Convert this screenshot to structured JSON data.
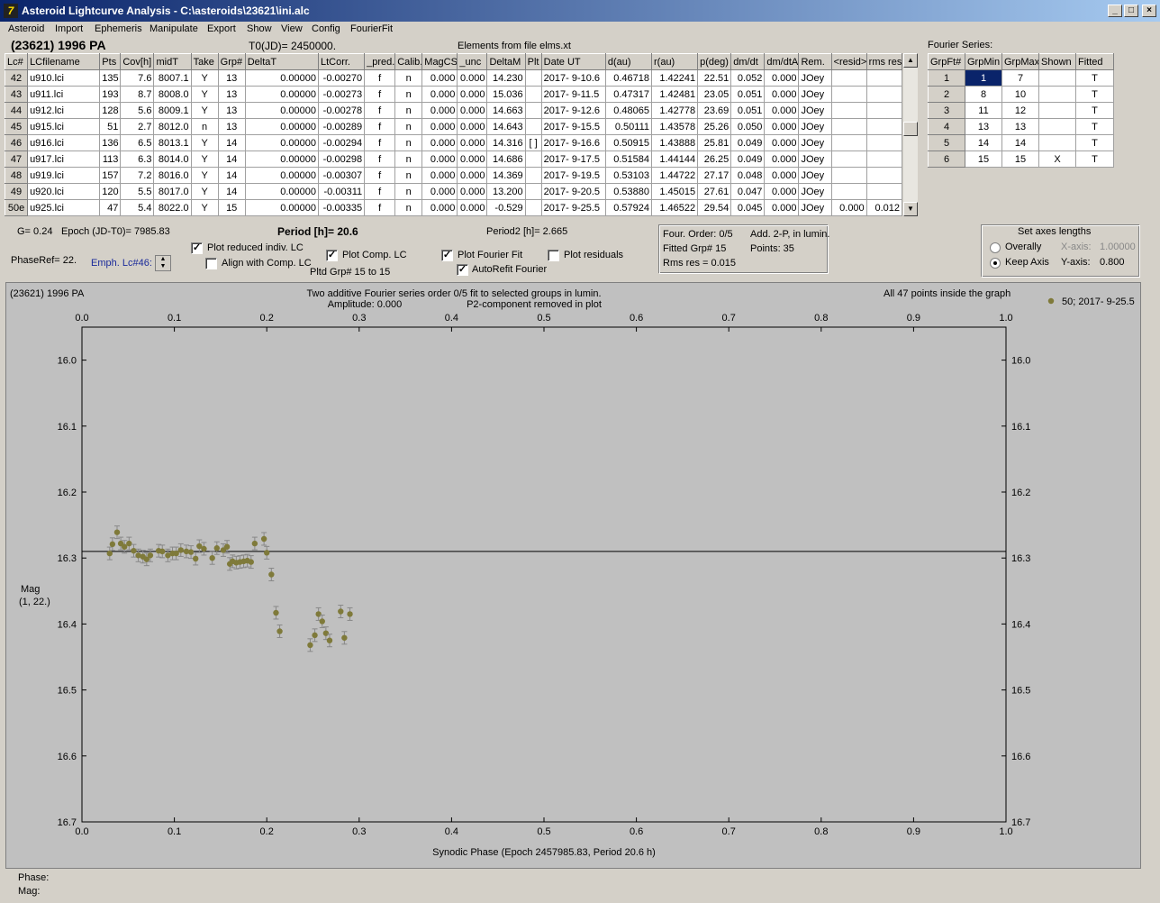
{
  "window": {
    "title": "Asteroid Lightcurve Analysis - C:\\asteroids\\23621\\ini.alc",
    "min": "_",
    "max": "□",
    "close": "×",
    "icon_letter": "7"
  },
  "menu": [
    "Asteroid",
    "Import",
    "Ephemeris",
    "Manipulate",
    "Export",
    "Show",
    "View",
    "Config",
    "FourierFit"
  ],
  "header": {
    "asteroid": "(23621) 1996 PA",
    "t0": "T0(JD)= 2450000.",
    "elements": "Elements from file elms.xt",
    "fourier_label": "Fourier Series:"
  },
  "lc_table": {
    "columns": [
      "Lc#",
      "LCfilename",
      "Pts",
      "Cov[h]",
      "midT",
      "Take",
      "Grp#",
      "DeltaT",
      "LtCorr.",
      "_pred.",
      "Calib.",
      "MagCS",
      "_unc",
      "DeltaM",
      "Plt",
      "Date UT",
      "d(au)",
      "r(au)",
      "p(deg)",
      "dm/dt",
      "dm/dtA",
      "Rem.",
      "<resid>",
      "rms res"
    ],
    "rows": [
      [
        "42",
        "u910.lci",
        "135",
        "7.6",
        "8007.1",
        "Y",
        "13",
        "0.00000",
        "-0.00270",
        "f",
        "n",
        "0.000",
        "0.000",
        "14.230",
        "",
        "2017- 9-10.6",
        "0.46718",
        "1.42241",
        "22.51",
        "0.052",
        "0.000",
        "JOey",
        "",
        ""
      ],
      [
        "43",
        "u911.lci",
        "193",
        "8.7",
        "8008.0",
        "Y",
        "13",
        "0.00000",
        "-0.00273",
        "f",
        "n",
        "0.000",
        "0.000",
        "15.036",
        "",
        "2017- 9-11.5",
        "0.47317",
        "1.42481",
        "23.05",
        "0.051",
        "0.000",
        "JOey",
        "",
        ""
      ],
      [
        "44",
        "u912.lci",
        "128",
        "5.6",
        "8009.1",
        "Y",
        "13",
        "0.00000",
        "-0.00278",
        "f",
        "n",
        "0.000",
        "0.000",
        "14.663",
        "",
        "2017- 9-12.6",
        "0.48065",
        "1.42778",
        "23.69",
        "0.051",
        "0.000",
        "JOey",
        "",
        ""
      ],
      [
        "45",
        "u915.lci",
        "51",
        "2.7",
        "8012.0",
        "n",
        "13",
        "0.00000",
        "-0.00289",
        "f",
        "n",
        "0.000",
        "0.000",
        "14.643",
        "",
        "2017- 9-15.5",
        "0.50111",
        "1.43578",
        "25.26",
        "0.050",
        "0.000",
        "JOey",
        "",
        ""
      ],
      [
        "46",
        "u916.lci",
        "136",
        "6.5",
        "8013.1",
        "Y",
        "14",
        "0.00000",
        "-0.00294",
        "f",
        "n",
        "0.000",
        "0.000",
        "14.316",
        "[ ]",
        "2017- 9-16.6",
        "0.50915",
        "1.43888",
        "25.81",
        "0.049",
        "0.000",
        "JOey",
        "",
        ""
      ],
      [
        "47",
        "u917.lci",
        "113",
        "6.3",
        "8014.0",
        "Y",
        "14",
        "0.00000",
        "-0.00298",
        "f",
        "n",
        "0.000",
        "0.000",
        "14.686",
        "",
        "2017- 9-17.5",
        "0.51584",
        "1.44144",
        "26.25",
        "0.049",
        "0.000",
        "JOey",
        "",
        ""
      ],
      [
        "48",
        "u919.lci",
        "157",
        "7.2",
        "8016.0",
        "Y",
        "14",
        "0.00000",
        "-0.00307",
        "f",
        "n",
        "0.000",
        "0.000",
        "14.369",
        "",
        "2017- 9-19.5",
        "0.53103",
        "1.44722",
        "27.17",
        "0.048",
        "0.000",
        "JOey",
        "",
        ""
      ],
      [
        "49",
        "u920.lci",
        "120",
        "5.5",
        "8017.0",
        "Y",
        "14",
        "0.00000",
        "-0.00311",
        "f",
        "n",
        "0.000",
        "0.000",
        "13.200",
        "",
        "2017- 9-20.5",
        "0.53880",
        "1.45015",
        "27.61",
        "0.047",
        "0.000",
        "JOey",
        "",
        ""
      ],
      [
        "50e",
        "u925.lci",
        "47",
        "5.4",
        "8022.0",
        "Y",
        "15",
        "0.00000",
        "-0.00335",
        "f",
        "n",
        "0.000",
        "0.000",
        "-0.529",
        "",
        "2017- 9-25.5",
        "0.57924",
        "1.46522",
        "29.54",
        "0.045",
        "0.000",
        "JOey",
        "0.000",
        "0.012"
      ]
    ]
  },
  "fourier_table": {
    "columns": [
      "GrpFt#",
      "GrpMin",
      "GrpMax",
      "Shown",
      "Fitted"
    ],
    "rows": [
      [
        "1",
        "1",
        "7",
        "",
        "T"
      ],
      [
        "2",
        "8",
        "10",
        "",
        "T"
      ],
      [
        "3",
        "11",
        "12",
        "",
        "T"
      ],
      [
        "4",
        "13",
        "13",
        "",
        "T"
      ],
      [
        "5",
        "14",
        "14",
        "",
        "T"
      ],
      [
        "6",
        "15",
        "15",
        "X",
        "T"
      ]
    ]
  },
  "params": {
    "g": "G= 0.24",
    "epoch": "Epoch (JD-T0)= 7985.83",
    "period": "Period [h]= 20.6",
    "period2": "Period2 [h]= 2.665",
    "phaseref": "PhaseRef= 22.",
    "emph": "Emph. Lc#46:",
    "pltd": "Pltd Grp#  15 to   15"
  },
  "checks": {
    "reduced": {
      "label": "Plot reduced indiv. LC",
      "checked": true
    },
    "align": {
      "label": "Align with Comp. LC",
      "checked": false
    },
    "comp": {
      "label": "Plot Comp. LC",
      "checked": true
    },
    "fourier": {
      "label": "Plot Fourier Fit",
      "checked": true
    },
    "autorefit": {
      "label": "AutoRefit Fourier",
      "checked": true
    },
    "resid": {
      "label": "Plot residuals",
      "checked": false
    }
  },
  "fitinfo": {
    "order": "Four. Order:  0/5",
    "add": "Add. 2-P, in lumin.",
    "fitted": "Fitted Grp# 15",
    "points": "Points: 35",
    "rms": "Rms res     = 0.015"
  },
  "axes_box": {
    "title": "Set axes lengths",
    "overally": "Overally",
    "keep": "Keep Axis",
    "xaxis_label": "X-axis:",
    "xaxis_val": "1.00000",
    "yaxis_label": "Y-axis:",
    "yaxis_val": "0.800"
  },
  "plot": {
    "name": "(23621) 1996 PA",
    "title1": "Two additive Fourier series order 0/5 fit to selected groups in lumin.",
    "title2": "Amplitude: 0.000",
    "title3": "P2-component removed in plot",
    "inside": "All 47 points inside the graph",
    "legend": "50; 2017- 9-25.5",
    "ylabel": "Mag",
    "ylabel2": "(1, 22.)",
    "xlabel": "Synodic Phase (Epoch 2457985.83, Period 20.6 h)"
  },
  "status": {
    "phase": "Phase:",
    "mag": "Mag:"
  },
  "chart_data": {
    "type": "scatter",
    "xlim": [
      0,
      1
    ],
    "ylim": [
      16.7,
      15.95
    ],
    "xticks": [
      "0.0",
      "0.1",
      "0.2",
      "0.3",
      "0.4",
      "0.5",
      "0.6",
      "0.7",
      "0.8",
      "0.9",
      "1.0"
    ],
    "yticks": [
      "16.0",
      "16.1",
      "16.2",
      "16.3",
      "16.4",
      "16.5",
      "16.6",
      "16.7"
    ],
    "fit_mag": 16.29,
    "point_color": "#7f7a3a",
    "series": [
      {
        "name": "50; 2017- 9-25.5",
        "x": [
          0.03,
          0.033,
          0.038,
          0.042,
          0.046,
          0.051,
          0.056,
          0.061,
          0.066,
          0.07,
          0.074,
          0.083,
          0.087,
          0.093,
          0.098,
          0.102,
          0.107,
          0.113,
          0.118,
          0.123,
          0.127,
          0.132,
          0.141,
          0.146,
          0.153,
          0.157,
          0.16,
          0.163,
          0.167,
          0.171,
          0.175,
          0.179,
          0.183,
          0.187,
          0.197,
          0.2,
          0.205,
          0.21,
          0.214,
          0.247,
          0.252,
          0.256,
          0.26,
          0.264,
          0.268,
          0.28,
          0.284,
          0.29
        ],
        "y": [
          16.293,
          16.279,
          16.261,
          16.278,
          16.283,
          16.278,
          16.289,
          16.296,
          16.298,
          16.302,
          16.296,
          16.289,
          16.29,
          16.296,
          16.293,
          16.293,
          16.288,
          16.29,
          16.291,
          16.301,
          16.282,
          16.286,
          16.3,
          16.285,
          16.288,
          16.283,
          16.309,
          16.305,
          16.307,
          16.306,
          16.305,
          16.304,
          16.306,
          16.278,
          16.271,
          16.292,
          16.325,
          16.383,
          16.411,
          16.432,
          16.417,
          16.385,
          16.396,
          16.414,
          16.425,
          16.381,
          16.421,
          16.385
        ]
      }
    ]
  }
}
